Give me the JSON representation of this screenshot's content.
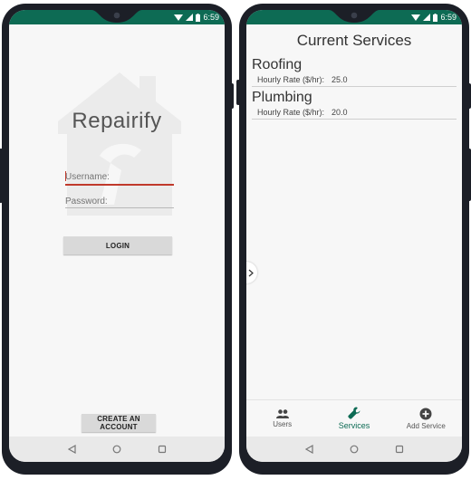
{
  "status": {
    "time": "6:59"
  },
  "login": {
    "app_title": "Repairify",
    "username_placeholder": "Username:",
    "password_placeholder": "Password:",
    "login_label": "LOGIN",
    "create_account_label": "CREATE AN ACCOUNT"
  },
  "services": {
    "title": "Current Services",
    "items": [
      {
        "name": "Roofing",
        "rate_label": "Hourly Rate ($/hr):",
        "rate_value": "25.0"
      },
      {
        "name": "Plumbing",
        "rate_label": "Hourly Rate ($/hr):",
        "rate_value": "20.0"
      }
    ],
    "bottom_nav": [
      {
        "label": "Users",
        "icon": "users-icon"
      },
      {
        "label": "Services",
        "icon": "wrench-icon"
      },
      {
        "label": "Add Service",
        "icon": "add-circle-icon"
      }
    ],
    "active_tab": "Services"
  },
  "colors": {
    "status_bar": "#0d6b54",
    "accent": "#0d6b54",
    "field_active_line": "#c0392b"
  }
}
